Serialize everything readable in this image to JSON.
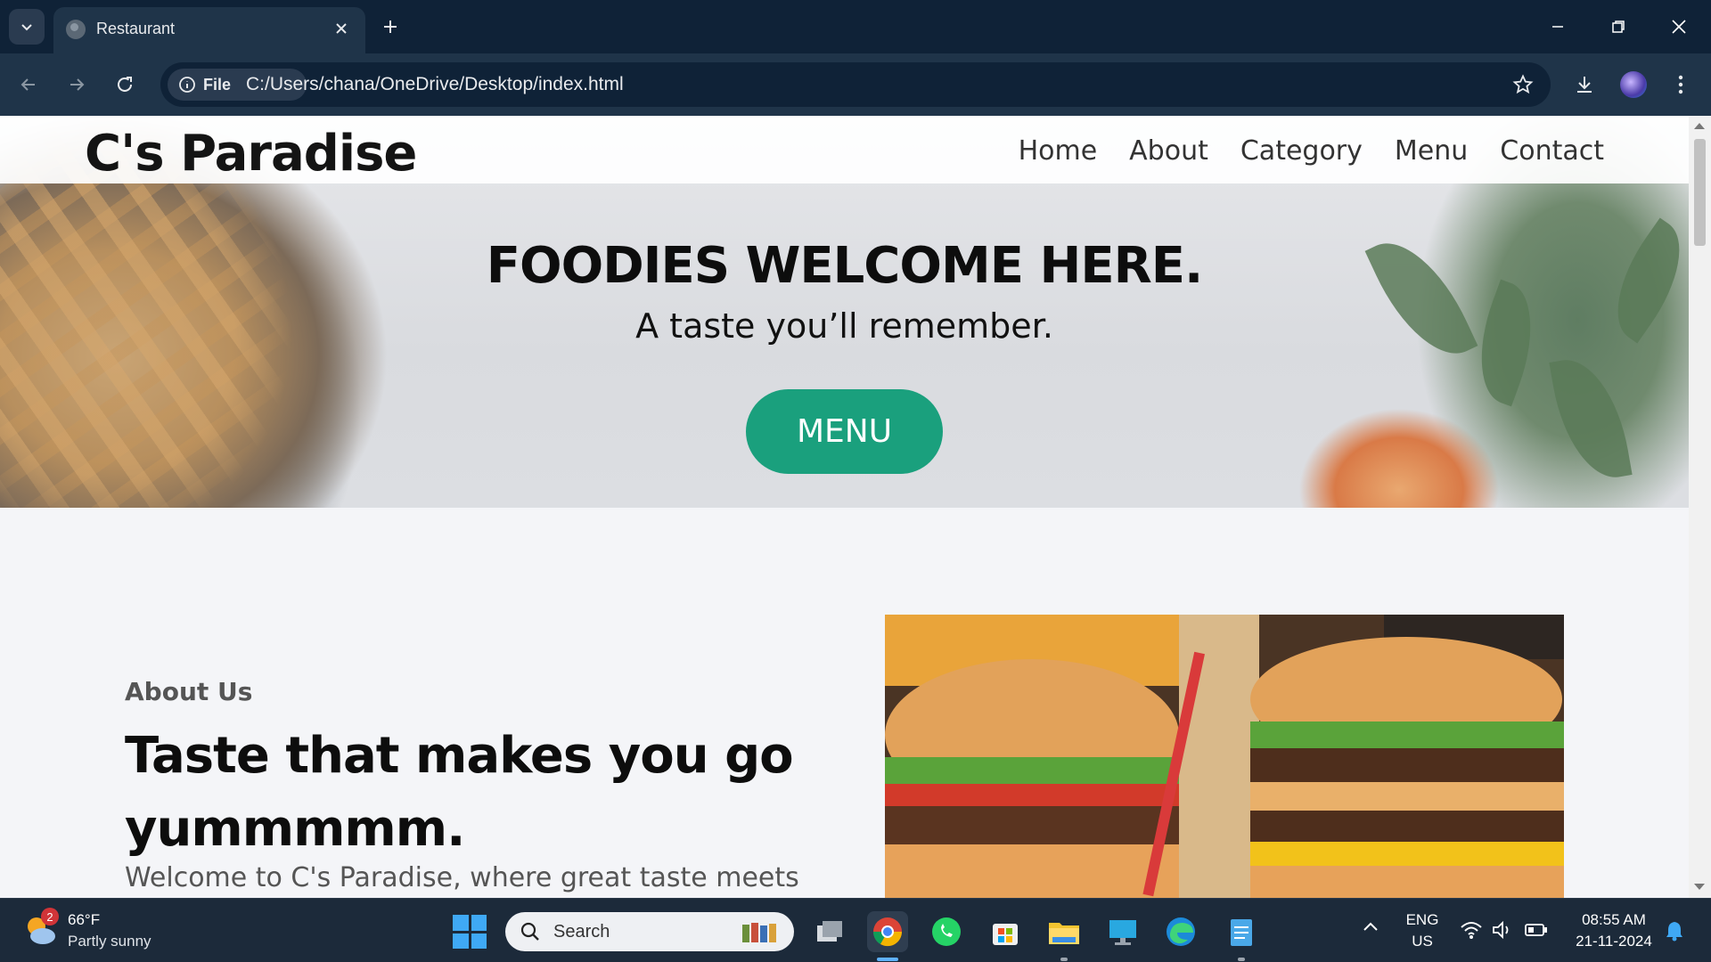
{
  "browser": {
    "tab_title": "Restaurant",
    "url_chip": "File",
    "url": "C:/Users/chana/OneDrive/Desktop/index.html"
  },
  "site": {
    "brand": "C's Paradise",
    "nav": [
      "Home",
      "About",
      "Category",
      "Menu",
      "Contact"
    ],
    "hero_title": "FOODIES WELCOME HERE.",
    "hero_subtitle": "A taste you’ll remember.",
    "hero_button": "MENU",
    "about_kicker": "About Us",
    "about_title": "Taste that makes you go yummmmm.",
    "about_text": "Welcome to C's Paradise, where great taste meets",
    "accent_color": "#1aa07d"
  },
  "taskbar": {
    "weather_temp": "66°F",
    "weather_desc": "Partly sunny",
    "weather_badge": "2",
    "search_label": "Search",
    "language_top": "ENG",
    "language_bottom": "US",
    "time": "08:55 AM",
    "date": "21-11-2024",
    "apps": [
      "file-explorer-icon",
      "chrome-icon",
      "whatsapp-icon",
      "microsoft-store-icon",
      "folder-icon",
      "remote-desktop-icon",
      "edge-icon",
      "notepad-icon"
    ]
  }
}
